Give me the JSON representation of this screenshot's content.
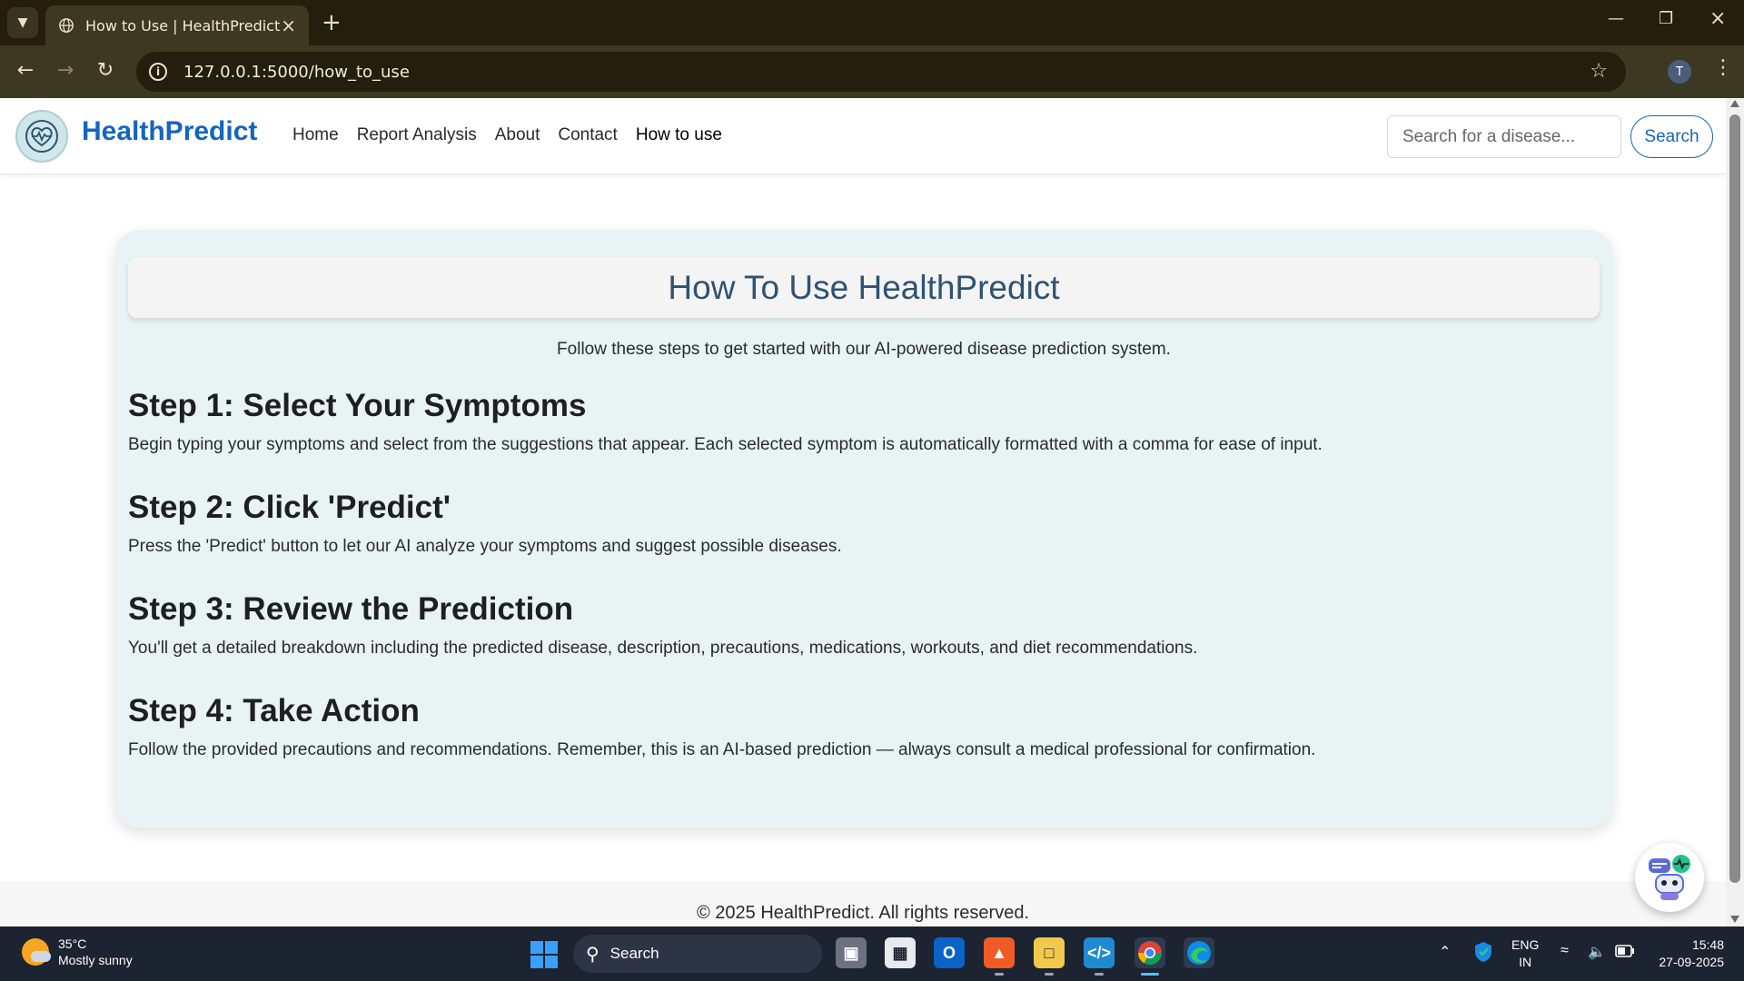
{
  "browser": {
    "tab_title": "How to Use | HealthPredict",
    "url": "127.0.0.1:5000/how_to_use",
    "profile_initial": "T"
  },
  "site": {
    "brand": "HealthPredict",
    "nav": [
      "Home",
      "Report Analysis",
      "About",
      "Contact",
      "How to use"
    ],
    "active_nav": "How to use",
    "search_placeholder": "Search for a disease...",
    "search_button": "Search"
  },
  "content": {
    "heading": "How To Use HealthPredict",
    "intro": "Follow these steps to get started with our AI-powered disease prediction system.",
    "steps": [
      {
        "title": "Step 1: Select Your Symptoms",
        "text": "Begin typing your symptoms and select from the suggestions that appear. Each selected symptom is automatically formatted with a comma for ease of input."
      },
      {
        "title": "Step 2: Click 'Predict'",
        "text": "Press the 'Predict' button to let our AI analyze your symptoms and suggest possible diseases."
      },
      {
        "title": "Step 3: Review the Prediction",
        "text": "You'll get a detailed breakdown including the predicted disease, description, precautions, medications, workouts, and diet recommendations."
      },
      {
        "title": "Step 4: Take Action",
        "text": "Follow the provided precautions and recommendations. Remember, this is an AI-based prediction — always consult a medical professional for confirmation."
      }
    ],
    "footer": "© 2025 HealthPredict. All rights reserved."
  },
  "taskbar": {
    "weather_temp": "35°C",
    "weather_desc": "Mostly sunny",
    "search_label": "Search",
    "lang_top": "ENG",
    "lang_bottom": "IN",
    "time": "15:48",
    "date": "27-09-2025"
  },
  "colors": {
    "brand": "#1565c0",
    "card_bg": "#e8f3f4",
    "heading": "#2f5272"
  }
}
